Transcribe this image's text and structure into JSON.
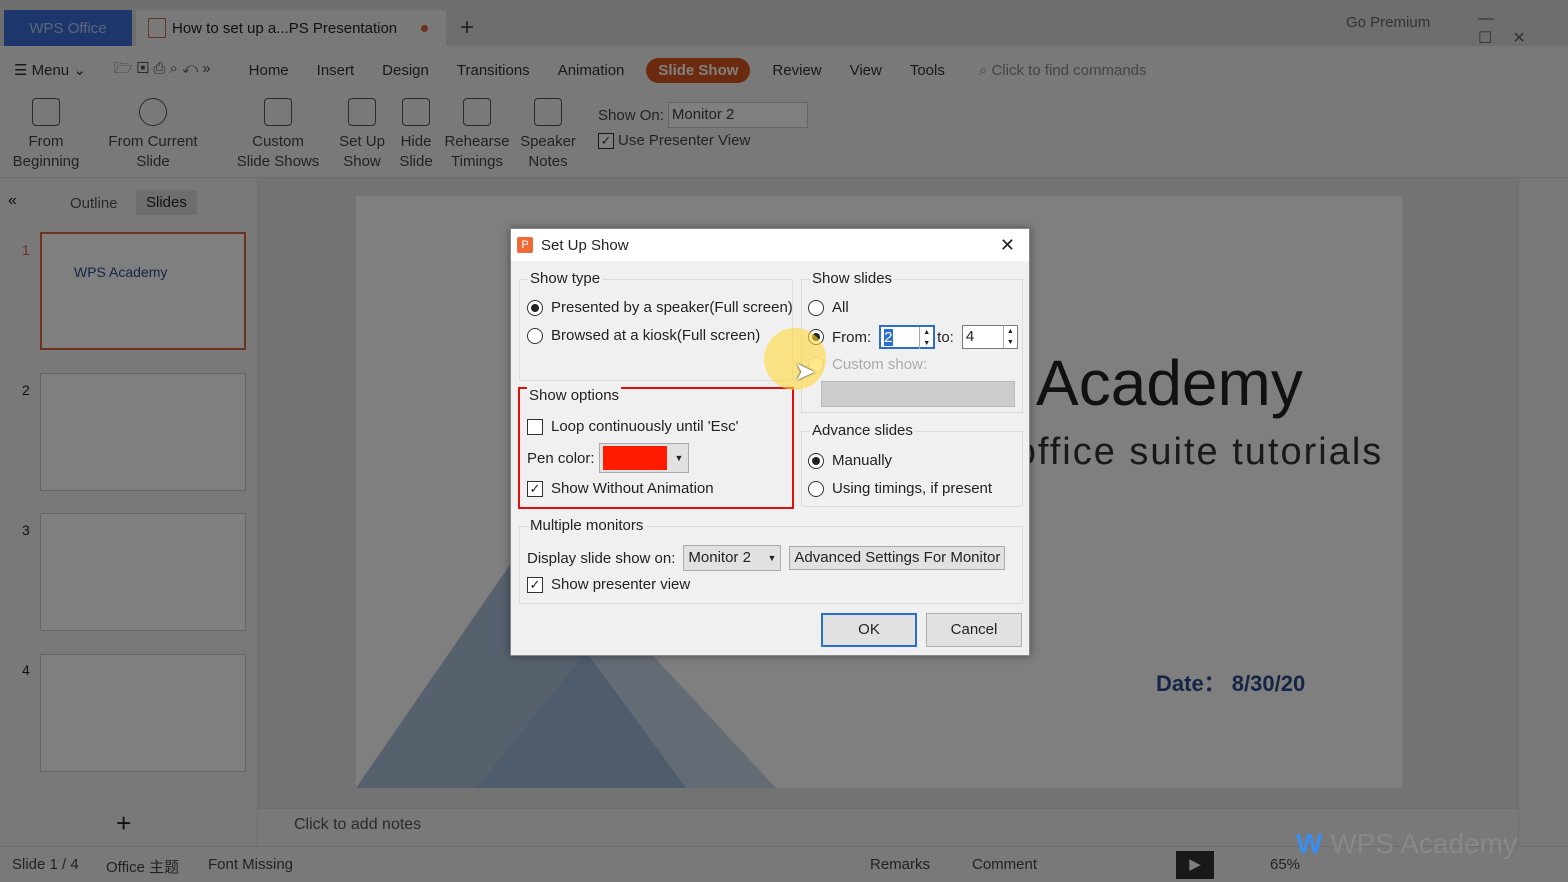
{
  "tabs": {
    "app": "WPS Office",
    "doc": "How to set up a...PS Presentation",
    "go_premium": "Go Premium"
  },
  "menu": {
    "menu": "Menu",
    "items": [
      "Home",
      "Insert",
      "Design",
      "Transitions",
      "Animation",
      "Slide Show",
      "Review",
      "View",
      "Tools"
    ],
    "search": "Click to find commands"
  },
  "ribbon": {
    "from_beginning": "From Beginning",
    "from_current": "From Current Slide",
    "custom": "Custom Slide Shows",
    "setup": "Set Up Show",
    "hide": "Hide Slide",
    "rehearse": "Rehearse Timings",
    "notes": "Speaker Notes",
    "show_on_label": "Show On:",
    "show_on_value": "Monitor 2",
    "use_presenter": "Use Presenter View"
  },
  "left": {
    "outline": "Outline",
    "slides": "Slides",
    "nums": [
      "1",
      "2",
      "3",
      "4"
    ]
  },
  "slide": {
    "title": "WPS Academy",
    "subtitle": "Free office suite tutorials",
    "date": "Date： 8/30/20"
  },
  "notes": "Click to add notes",
  "status": {
    "slide": "Slide 1 / 4",
    "theme": "Office 主题",
    "font": "Font Missing",
    "remarks": "Remarks",
    "comment": "Comment",
    "zoom": "65%"
  },
  "dialog": {
    "title": "Set Up Show",
    "show_type": {
      "label": "Show type",
      "opt1": "Presented by a speaker(Full screen)",
      "opt2": "Browsed at a kiosk(Full screen)"
    },
    "show_slides": {
      "label": "Show slides",
      "all": "All",
      "from": "From:",
      "from_value": "2",
      "to": "to:",
      "to_value": "4",
      "custom": "Custom show:"
    },
    "show_options": {
      "label": "Show options",
      "loop": "Loop continuously until 'Esc'",
      "pen": "Pen color:",
      "pen_color": "#ff1a00",
      "no_anim": "Show Without Animation"
    },
    "advance": {
      "label": "Advance slides",
      "manual": "Manually",
      "timings": "Using timings, if present"
    },
    "monitors": {
      "label": "Multiple monitors",
      "display": "Display slide show on:",
      "monitor": "Monitor 2",
      "advanced": "Advanced Settings For Monitor",
      "presenter": "Show presenter view"
    },
    "ok": "OK",
    "cancel": "Cancel"
  }
}
